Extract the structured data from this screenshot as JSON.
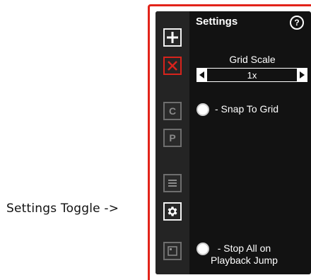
{
  "annotation": {
    "text": "Settings Toggle ->"
  },
  "panel": {
    "title": "Settings",
    "help_label": "?",
    "grid_scale": {
      "label": "Grid Scale",
      "value": "1x"
    },
    "toggles": {
      "snap_to_grid": {
        "label": "- Snap To Grid"
      },
      "stop_all": {
        "label_line1": "- Stop All on",
        "label_line2": "Playback Jump"
      }
    }
  },
  "toolbar": {
    "items": [
      {
        "icon": "plus-icon"
      },
      {
        "icon": "close-icon"
      },
      {
        "icon": "letter-c",
        "label": "C"
      },
      {
        "icon": "letter-p",
        "label": "P"
      },
      {
        "icon": "list-icon"
      },
      {
        "icon": "gear-icon"
      },
      {
        "icon": "frame-icon"
      }
    ]
  },
  "colors": {
    "highlight_red": "#e2231a",
    "panel_bg": "#121212",
    "toolbar_bg": "#242424"
  }
}
